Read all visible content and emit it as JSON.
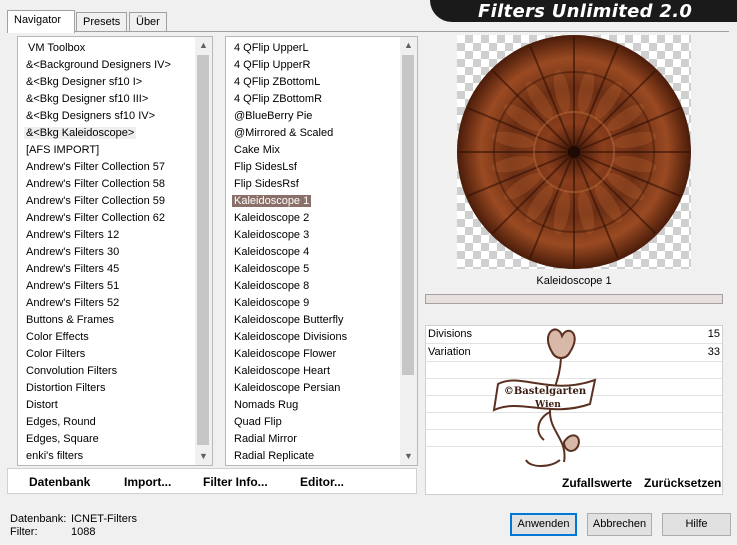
{
  "tabs": [
    "Navigator",
    "Presets",
    "Über"
  ],
  "banner_title": "Filters Unlimited 2.0",
  "categories": [
    "VM Toolbox",
    "&<Background Designers IV>",
    "&<Bkg Designer sf10 I>",
    "&<Bkg Designer sf10 III>",
    "&<Bkg Designers sf10 IV>",
    "&<Bkg Kaleidoscope>",
    "[AFS IMPORT]",
    "Andrew's Filter Collection 57",
    "Andrew's Filter Collection 58",
    "Andrew's Filter Collection 59",
    "Andrew's Filter Collection 62",
    "Andrew's Filters 12",
    "Andrew's Filters 30",
    "Andrew's Filters 45",
    "Andrew's Filters 51",
    "Andrew's Filters 52",
    "Buttons & Frames",
    "Color Effects",
    "Color Filters",
    "Convolution Filters",
    "Distortion Filters",
    "Distort",
    "Edges, Round",
    "Edges, Square",
    "enki's filters"
  ],
  "filters": [
    "4 QFlip UpperL",
    "4 QFlip UpperR",
    "4 QFlip ZBottomL",
    "4 QFlip ZBottomR",
    "@BlueBerry Pie",
    "@Mirrored & Scaled",
    "Cake Mix",
    "Flip SidesLsf",
    "Flip SidesRsf",
    "Kaleidoscope 1",
    "Kaleidoscope 2",
    "Kaleidoscope 3",
    "Kaleidoscope 4",
    "Kaleidoscope 5",
    "Kaleidoscope 8",
    "Kaleidoscope 9",
    "Kaleidoscope Butterfly",
    "Kaleidoscope Divisions",
    "Kaleidoscope Flower",
    "Kaleidoscope Heart",
    "Kaleidoscope Persian",
    "Nomads Rug",
    "Quad Flip",
    "Radial Mirror",
    "Radial Replicate"
  ],
  "toolbar": {
    "database": "Datenbank",
    "import": "Import...",
    "filter_info": "Filter Info...",
    "editor": "Editor..."
  },
  "preview": {
    "filter_name": "Kaleidoscope 1"
  },
  "params": [
    {
      "name": "Divisions",
      "value": "15"
    },
    {
      "name": "Variation",
      "value": "33"
    }
  ],
  "watermark": {
    "line1": "©Bastelgarten",
    "line2": "Wien"
  },
  "param_buttons": {
    "random": "Zufallswerte",
    "reset": "Zurücksetzen"
  },
  "status": {
    "db_label": "Datenbank:",
    "db_value": "ICNET-Filters",
    "filter_label": "Filter:",
    "filter_value": "1088"
  },
  "buttons": {
    "apply": "Anwenden",
    "cancel": "Abbrechen",
    "help": "Hilfe"
  },
  "colors": {
    "selection": "#8a7068",
    "banner": "#1a1a1a",
    "kaleidoscope": "#6b2e14"
  }
}
